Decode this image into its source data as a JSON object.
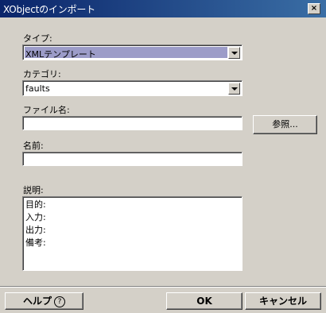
{
  "window": {
    "title": "XObjectのインポート",
    "close_label": "×"
  },
  "form": {
    "type_label": "タイプ:",
    "type_value": "XMLテンプレート",
    "category_label": "カテゴリ:",
    "category_value": "faults",
    "filename_label": "ファイル名:",
    "filename_value": "",
    "browse_label": "参照...",
    "name_label": "名前:",
    "name_value": "",
    "description_label": "説明:",
    "description_lines": [
      "目的:",
      "入力:",
      "出力:",
      "備考:"
    ]
  },
  "footer": {
    "help_label": "ヘルプ",
    "help_icon": "?",
    "ok_label": "OK",
    "cancel_label": "キャンセル"
  }
}
